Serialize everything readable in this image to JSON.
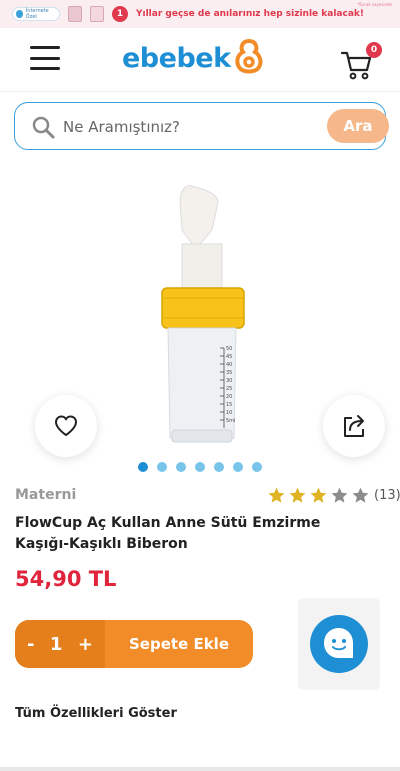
{
  "promo": {
    "pill_text": "İnternete Özel",
    "badge": "1",
    "text": "Yıllar geçse de anılarınız hep sizinle kalacak!",
    "note": "*Evrak sayesinde"
  },
  "header": {
    "logo_text": "ebebek",
    "cart_count": "0"
  },
  "search": {
    "placeholder": "Ne Aramıştınız?",
    "button_label": "Ara"
  },
  "gallery": {
    "dots": 7,
    "active_index": 0,
    "scale_marks": [
      "50",
      "45",
      "40",
      "35",
      "30",
      "25",
      "20",
      "15",
      "10",
      "5ml"
    ]
  },
  "product": {
    "brand": "Materni",
    "rating_stars": 3,
    "rating_max": 5,
    "rating_count": "(13)",
    "title": "FlowCup Aç Kullan Anne Sütü Emzirme Kaşığı-Kaşıklı Biberon",
    "price": "54,90 TL"
  },
  "cart_bar": {
    "minus": "-",
    "quantity": "1",
    "plus": "+",
    "add_label": "Sepete Ekle"
  },
  "footer": {
    "features_link": "Tüm Özellikleri Göster"
  },
  "colors": {
    "brand_blue": "#1e8fd4",
    "orange": "#f28c28",
    "price_red": "#e0243c"
  }
}
